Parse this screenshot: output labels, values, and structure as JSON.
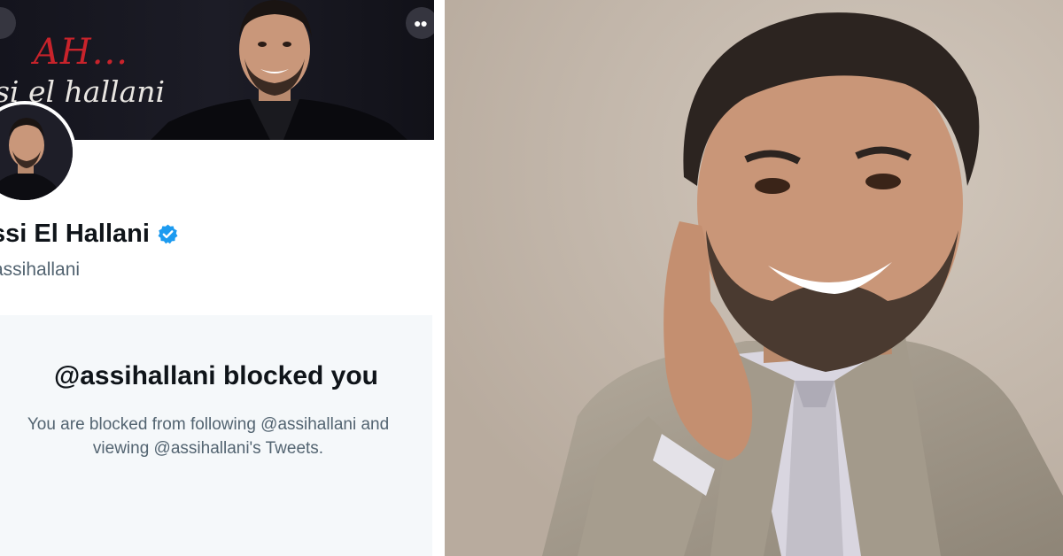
{
  "profile": {
    "banner_script": "AH...",
    "banner_name": "si el hallani",
    "display_name": "ssi El Hallani",
    "handle": "assihallani",
    "more_icon": "more-icon",
    "verified_icon": "verified-badge-icon"
  },
  "blocked_notice": {
    "title": "@assihallani blocked you",
    "line1": "You are blocked from following @assihallani and",
    "line2": "viewing @assihallani's Tweets."
  },
  "colors": {
    "verified_blue": "#1d9bf0",
    "banner_red": "#c8232b",
    "card_background": "#f5f8fa"
  }
}
